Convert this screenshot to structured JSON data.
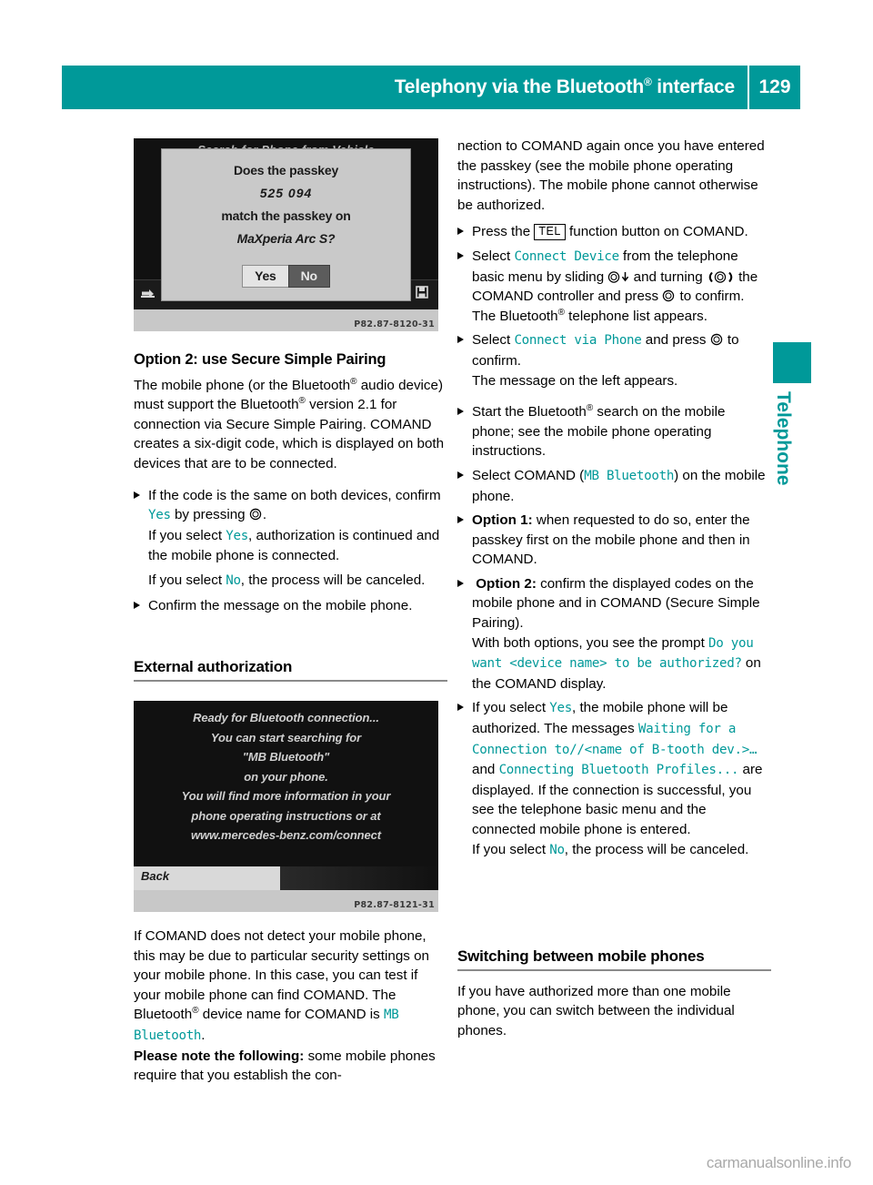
{
  "header": {
    "title_before": "Telephony via the Bluetooth",
    "title_reg": "®",
    "title_after": " interface",
    "page_number": "129",
    "accent_color": "#009999"
  },
  "side_tab": {
    "label": "Telephone"
  },
  "screenshot_1": {
    "list_title": "Search for Phone from Vehicle",
    "list_row": "MaXperia Arc S",
    "dialog": {
      "line1": "Does the passkey",
      "code": "525 094",
      "line2": "match the passkey on",
      "device": "MaXperia Arc S?",
      "btn_yes": "Yes",
      "btn_no": "No"
    },
    "photo_code": "P82.87-8120-31"
  },
  "screenshot_2": {
    "lines": [
      "Ready for Bluetooth connection...",
      "You can start searching for",
      "\"MB Bluetooth\"",
      "on your phone.",
      "You will find more information in your",
      "phone operating instructions or at",
      "www.mercedes-benz.com/connect"
    ],
    "back_label": "Back",
    "photo_code": "P82.87-8121-31"
  },
  "left_column": {
    "heading_option2": "Option 2: use Secure Simple Pairing",
    "para_1_a": "The mobile phone (or the Bluetooth",
    "para_1_b": " audio device) must support the Bluetooth",
    "para_1_c": " version 2.1 for connection via Secure Simple Pairing. COMAND creates a six-digit code, which is displayed on both devices that are to be connected.",
    "bullet_1_a": "If the code is the same on both devices, confirm ",
    "bullet_1_yes": "Yes",
    "bullet_1_b": " by pressing ",
    "bullet_1_c": ".",
    "bullet_1_sub_a": "If you select ",
    "bullet_1_sub_yes": "Yes",
    "bullet_1_sub_b": ", authorization is continued and the mobile phone is connected.",
    "bullet_1_sub2_a": "If you select ",
    "bullet_1_sub2_no": "No",
    "bullet_1_sub2_b": ", the process will be canceled.",
    "bullet_2": "Confirm the message on the mobile phone.",
    "heading_external": "External authorization",
    "para_2_a": "If COMAND does not detect your mobile phone, this may be due to particular security settings on your mobile phone. In this case, you can test if your mobile phone can find COMAND. The Bluetooth",
    "para_2_b": " device name for COMAND is ",
    "para_2_mono": "MB Bluetooth",
    "para_2_c": ".",
    "para_3_bold": "Please note the following:",
    "para_3_text": " some mobile phones require that you establish the con-"
  },
  "right_column": {
    "para_top": "nection to COMAND again once you have entered the passkey (see the mobile phone operating instructions). The mobile phone cannot otherwise be authorized.",
    "b1_a": "Press the ",
    "b1_key": "TEL",
    "b1_b": " function button on COMAND.",
    "b2_a": "Select ",
    "b2_mono": "Connect Device",
    "b2_b": " from the telephone basic menu by sliding ",
    "b2_c": " and turning ",
    "b2_d": " the COMAND controller and press ",
    "b2_e": " to confirm.",
    "b2_sub_a": "The Bluetooth",
    "b2_sub_b": " telephone list appears.",
    "b3_a": "Select ",
    "b3_mono": "Connect via Phone",
    "b3_b": " and press ",
    "b3_c": " to confirm.",
    "b3_sub": "The message on the left appears.",
    "b4_a": "Start the Bluetooth",
    "b4_b": " search on the mobile phone; see the mobile phone operating instructions.",
    "b5_a": "Select COMAND (",
    "b5_mono": "MB Bluetooth",
    "b5_b": ") on the mobile phone.",
    "b6_bold": "Option 1:",
    "b6_text": " when requested to do so, enter the passkey first on the mobile phone and then in COMAND.",
    "b7_bold": "Option 2:",
    "b7_text": " confirm the displayed codes on the mobile phone and in COMAND (Secure Simple Pairing).",
    "b7_sub_a": "With both options, you see the prompt ",
    "b7_sub_mono": "Do you want <device name> to be authorized?",
    "b7_sub_b": " on the COMAND display.",
    "b8_a": "If you select ",
    "b8_yes": "Yes",
    "b8_b": ", the mobile phone will be authorized. The messages ",
    "b8_mono1": "Waiting for a Connection to//<name of B-tooth dev.>…",
    "b8_c": " and ",
    "b8_mono2": "Connecting Bluetooth Profiles...",
    "b8_d": " are displayed. If the connection is successful, you see the telephone basic menu and the connected mobile phone is entered.",
    "b8_sub_a": "If you select ",
    "b8_sub_no": "No",
    "b8_sub_b": ", the process will be canceled.",
    "heading_switching": "Switching between mobile phones",
    "para_switching": "If you have authorized more than one mobile phone, you can switch between the individual phones."
  },
  "watermark": {
    "text": "carmanualsonline.info"
  }
}
